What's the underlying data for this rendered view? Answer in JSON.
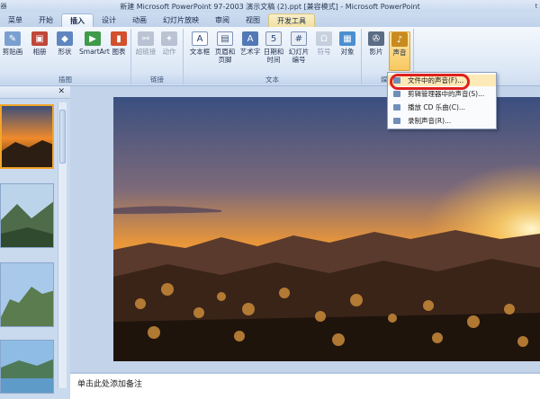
{
  "window": {
    "title": "新建 Microsoft PowerPoint 97-2003 演示文稿 (2).ppt [兼容模式] - Microsoft PowerPoint",
    "title_left_fragment": "器",
    "title_right_fragment": "t"
  },
  "tabs": [
    {
      "label": "菜单",
      "active": false
    },
    {
      "label": "开始",
      "active": false
    },
    {
      "label": "插入",
      "active": true
    },
    {
      "label": "设计",
      "active": false
    },
    {
      "label": "动画",
      "active": false
    },
    {
      "label": "幻灯片放映",
      "active": false
    },
    {
      "label": "审阅",
      "active": false
    },
    {
      "label": "视图",
      "active": false
    },
    {
      "label": "开发工具",
      "active": false
    }
  ],
  "ribbon": {
    "groups": [
      {
        "label": "插图",
        "buttons": [
          "剪贴画",
          "相册",
          "形状",
          "SmartArt",
          "图表"
        ]
      },
      {
        "label": "链接",
        "buttons": [
          "超链接",
          "动作"
        ]
      },
      {
        "label": "文本",
        "buttons": [
          "文本框",
          "页眉和页脚",
          "艺术字",
          "日期和时间",
          "幻灯片编号",
          "符号",
          "对象"
        ]
      },
      {
        "label": "媒体",
        "buttons": [
          "影片",
          "声音"
        ]
      }
    ]
  },
  "sound_menu": {
    "items": [
      "文件中的声音(F)...",
      "剪辑管理器中的声音(S)...",
      "播放 CD 乐曲(C)...",
      "录制声音(R)..."
    ]
  },
  "notes": {
    "placeholder": "单击此处添加备注"
  },
  "colors": {
    "accent_highlight": "#f8c860",
    "annotation_red": "#e02020",
    "ribbon_bg": "#dde8f6"
  }
}
